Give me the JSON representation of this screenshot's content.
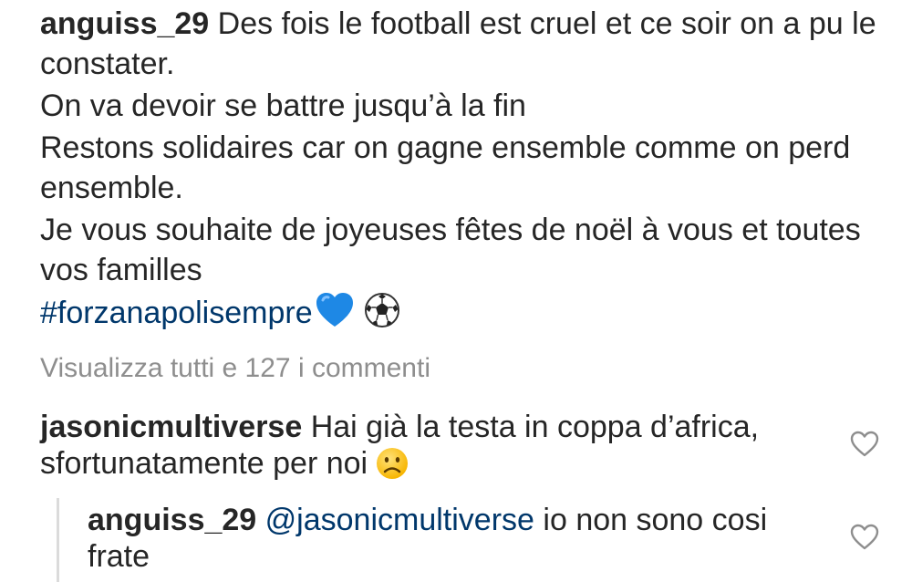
{
  "post": {
    "username": "anguiss_29",
    "caption_line1": "Des fois le football est cruel et ce soir on a pu le constater.",
    "caption_line2": "On va devoir se battre jusqu’à la fin",
    "caption_line3": "Restons solidaires car on gagne ensemble comme on perd ensemble.",
    "caption_line4": "Je vous souhaite de joyeuses fêtes de noël à vous et toutes vos familles",
    "hashtag": "#forzanapolisempre",
    "emojis": [
      "blue-heart-icon",
      "soccer-ball-icon"
    ]
  },
  "view_all_comments": "Visualizza tutti e 127 i commenti",
  "comments": [
    {
      "username": "jasonicmultiverse",
      "text": "Hai già la testa in coppa d’africa, sfortunatamente per noi",
      "emoji": "sad-face-icon"
    }
  ],
  "replies": [
    {
      "username": "anguiss_29",
      "mention": "@jasonicmultiverse",
      "text": "io non sono cosi frate"
    }
  ],
  "colors": {
    "text": "#262626",
    "link": "#00376b",
    "muted": "#8e8e8e",
    "heart_emoji": "#1e88e5"
  }
}
